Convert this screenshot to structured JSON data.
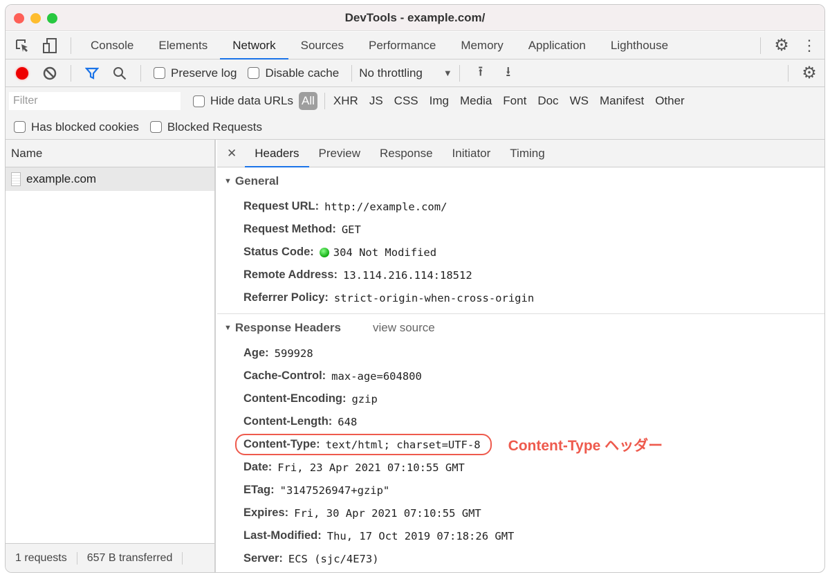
{
  "window": {
    "title": "DevTools - example.com/"
  },
  "tabs": [
    "Console",
    "Elements",
    "Network",
    "Sources",
    "Performance",
    "Memory",
    "Application",
    "Lighthouse"
  ],
  "toolbar": {
    "preserve_log": "Preserve log",
    "disable_cache": "Disable cache",
    "throttling": "No throttling"
  },
  "filter": {
    "placeholder": "Filter",
    "hide_data_urls": "Hide data URLs",
    "types": [
      "All",
      "XHR",
      "JS",
      "CSS",
      "Img",
      "Media",
      "Font",
      "Doc",
      "WS",
      "Manifest",
      "Other"
    ],
    "has_blocked_cookies": "Has blocked cookies",
    "blocked_requests": "Blocked Requests"
  },
  "requests": {
    "header": "Name",
    "items": [
      "example.com"
    ],
    "footer": {
      "count": "1 requests",
      "transferred": "657 B transferred"
    }
  },
  "detail_tabs": [
    "Headers",
    "Preview",
    "Response",
    "Initiator",
    "Timing"
  ],
  "general": {
    "title": "General",
    "rows": [
      {
        "k": "Request URL:",
        "v": "http://example.com/"
      },
      {
        "k": "Request Method:",
        "v": "GET"
      },
      {
        "k": "Status Code:",
        "v": "304 Not Modified"
      },
      {
        "k": "Remote Address:",
        "v": "13.114.216.114:18512"
      },
      {
        "k": "Referrer Policy:",
        "v": "strict-origin-when-cross-origin"
      }
    ]
  },
  "response": {
    "title": "Response Headers",
    "view_source": "view source",
    "rows": [
      {
        "k": "Age:",
        "v": "599928"
      },
      {
        "k": "Cache-Control:",
        "v": "max-age=604800"
      },
      {
        "k": "Content-Encoding:",
        "v": "gzip"
      },
      {
        "k": "Content-Length:",
        "v": "648"
      },
      {
        "k": "Content-Type:",
        "v": "text/html; charset=UTF-8"
      },
      {
        "k": "Date:",
        "v": "Fri, 23 Apr 2021 07:10:55 GMT"
      },
      {
        "k": "ETag:",
        "v": "\"3147526947+gzip\""
      },
      {
        "k": "Expires:",
        "v": "Fri, 30 Apr 2021 07:10:55 GMT"
      },
      {
        "k": "Last-Modified:",
        "v": "Thu, 17 Oct 2019 07:18:26 GMT"
      },
      {
        "k": "Server:",
        "v": "ECS (sjc/4E73)"
      }
    ]
  },
  "annotation": "Content-Type ヘッダー"
}
